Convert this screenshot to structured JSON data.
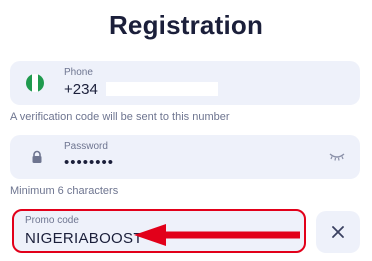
{
  "page": {
    "title": "Registration"
  },
  "phone": {
    "label": "Phone",
    "country_code": "+234",
    "country_flag": "nigeria-flag-icon",
    "hint": "A verification code will be sent to this number"
  },
  "password": {
    "label": "Password",
    "value": "••••••••",
    "icon": "lock-icon",
    "toggle_icon": "eye-closed-icon",
    "hint": "Minimum 6 characters"
  },
  "promo": {
    "label": "Promo code",
    "value": "NIGERIABOOST",
    "highlight_color": "#e2001a",
    "clear_icon": "close-icon"
  },
  "colors": {
    "title": "#1b1f3a",
    "field_bg": "#eef1fa",
    "hint_text": "#6e7590",
    "annotation_red": "#e2001a"
  }
}
